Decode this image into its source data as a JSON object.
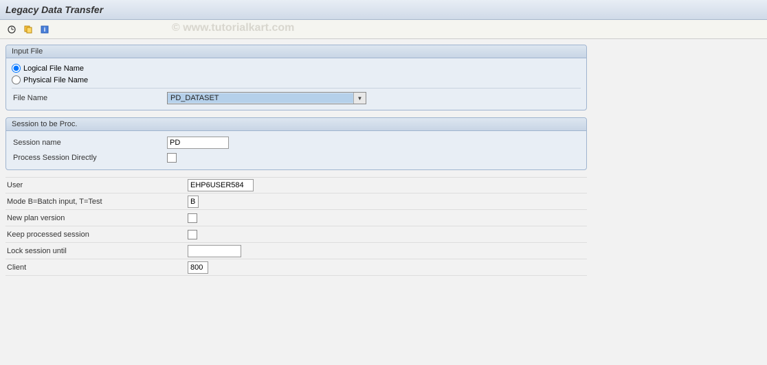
{
  "title": "Legacy Data Transfer",
  "watermark": "© www.tutorialkart.com",
  "inputFile": {
    "header": "Input File",
    "logicalLabel": "Logical File Name",
    "physicalLabel": "Physical File Name",
    "fileNameLabel": "File Name",
    "fileNameValue": "PD_DATASET"
  },
  "session": {
    "header": "Session to be Proc.",
    "sessionNameLabel": "Session name",
    "sessionNameValue": "PD",
    "processDirectLabel": "Process Session Directly"
  },
  "params": {
    "userLabel": "User",
    "userValue": "EHP6USER584",
    "modeLabel": "Mode   B=Batch input, T=Test",
    "modeValue": "B",
    "newPlanLabel": "New plan version",
    "keepSessionLabel": "Keep processed session",
    "lockUntilLabel": "Lock session until",
    "lockUntilValue": "",
    "clientLabel": "Client",
    "clientValue": "800"
  }
}
